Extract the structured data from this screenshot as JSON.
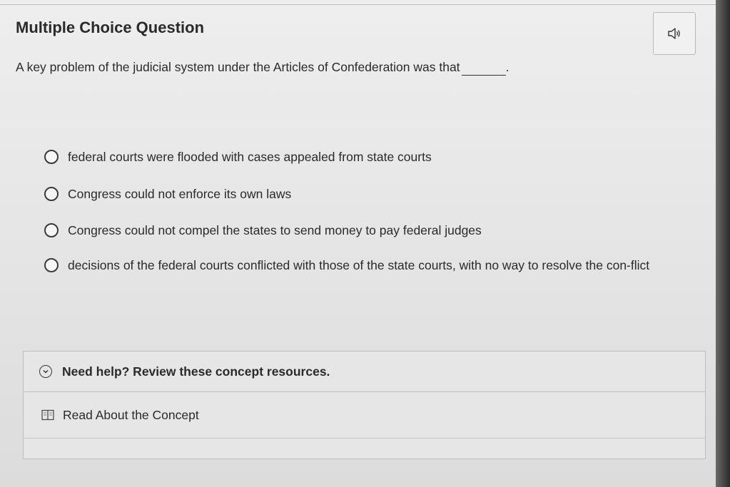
{
  "header": {
    "title": "Multiple Choice Question",
    "audio_icon": "speaker-icon"
  },
  "question": {
    "text": "A key problem of the judicial system under the Articles of Confederation was that",
    "blank_suffix": "."
  },
  "options": [
    {
      "label": "federal courts were flooded with cases appealed from state courts"
    },
    {
      "label": "Congress could not enforce its own laws"
    },
    {
      "label": "Congress could not compel the states to send money to pay federal judges"
    },
    {
      "label": "decisions of the federal courts conflicted with those of the state courts, with no way to resolve the con-flict"
    }
  ],
  "help": {
    "toggle_label": "Need help? Review these concept resources.",
    "toggle_icon": "chevron-down-circle-icon",
    "resources": [
      {
        "label": "Read About the Concept",
        "icon": "book-icon"
      }
    ]
  }
}
